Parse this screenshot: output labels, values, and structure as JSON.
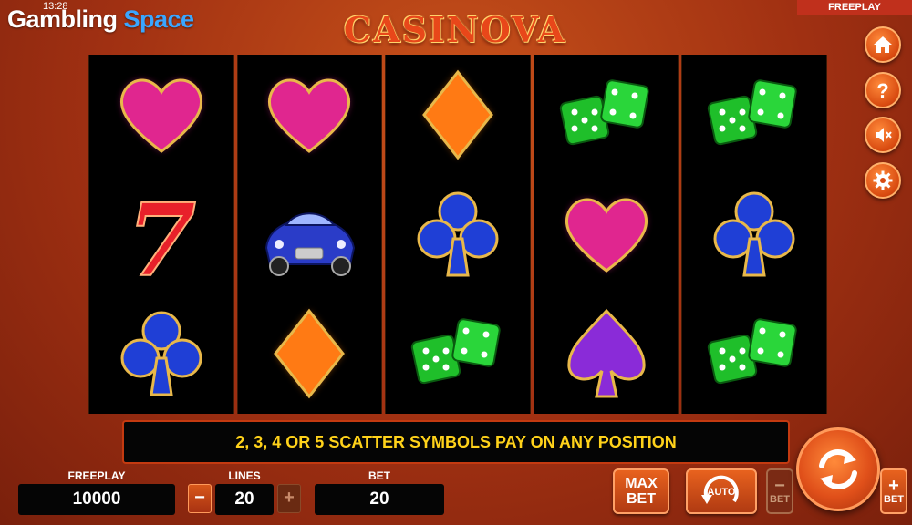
{
  "status": {
    "clock": "13:28"
  },
  "branding": {
    "logo_part1": "Gambling ",
    "logo_part2": "Space",
    "game_title": "CASINOVA"
  },
  "mode_tag": "FREEPLAY",
  "side_buttons": [
    {
      "name": "home",
      "icon": "home-icon"
    },
    {
      "name": "help",
      "icon": "question-icon"
    },
    {
      "name": "sound",
      "icon": "mute-icon"
    },
    {
      "name": "settings",
      "icon": "gear-icon"
    }
  ],
  "reels": [
    [
      "heart",
      "seven",
      "club"
    ],
    [
      "heart",
      "car",
      "diamond"
    ],
    [
      "diamond",
      "club",
      "dice"
    ],
    [
      "dice",
      "heart",
      "spade"
    ],
    [
      "dice",
      "club",
      "dice"
    ]
  ],
  "info_message": "2, 3, 4 OR 5 SCATTER SYMBOLS PAY ON ANY POSITION",
  "bottom": {
    "balance_label": "FREEPLAY",
    "balance_value": "10000",
    "lines_label": "LINES",
    "lines_value": "20",
    "lines_minus": "−",
    "lines_plus": "+",
    "bet_label": "BET",
    "bet_value": "20",
    "maxbet_line1": "MAX",
    "maxbet_line2": "BET",
    "auto_label": "AUTO",
    "bet_minus_label": "BET",
    "bet_plus_label": "BET"
  },
  "colors": {
    "heart": "#e0268f",
    "diamond": "#ff7a14",
    "club": "#1f3fd6",
    "spade": "#8a2bd8",
    "seven": "#e8202a",
    "dice": "#1fbf2a",
    "car": "#2a3cc8",
    "symbol_rim": "#e8b84a",
    "info_text": "#ffd21a"
  }
}
